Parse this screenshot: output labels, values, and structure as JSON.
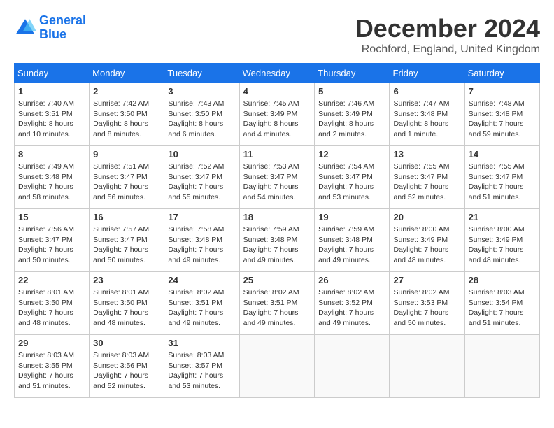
{
  "header": {
    "logo_line1": "General",
    "logo_line2": "Blue",
    "month": "December 2024",
    "location": "Rochford, England, United Kingdom"
  },
  "weekdays": [
    "Sunday",
    "Monday",
    "Tuesday",
    "Wednesday",
    "Thursday",
    "Friday",
    "Saturday"
  ],
  "weeks": [
    [
      {
        "day": "1",
        "sunrise": "7:40 AM",
        "sunset": "3:51 PM",
        "daylight_hours": "8 hours",
        "daylight_minutes": "10 minutes."
      },
      {
        "day": "2",
        "sunrise": "7:42 AM",
        "sunset": "3:50 PM",
        "daylight_hours": "8 hours",
        "daylight_minutes": "8 minutes."
      },
      {
        "day": "3",
        "sunrise": "7:43 AM",
        "sunset": "3:50 PM",
        "daylight_hours": "8 hours",
        "daylight_minutes": "6 minutes."
      },
      {
        "day": "4",
        "sunrise": "7:45 AM",
        "sunset": "3:49 PM",
        "daylight_hours": "8 hours",
        "daylight_minutes": "4 minutes."
      },
      {
        "day": "5",
        "sunrise": "7:46 AM",
        "sunset": "3:49 PM",
        "daylight_hours": "8 hours",
        "daylight_minutes": "2 minutes."
      },
      {
        "day": "6",
        "sunrise": "7:47 AM",
        "sunset": "3:48 PM",
        "daylight_hours": "8 hours",
        "daylight_minutes": "1 minute."
      },
      {
        "day": "7",
        "sunrise": "7:48 AM",
        "sunset": "3:48 PM",
        "daylight_hours": "7 hours",
        "daylight_minutes": "59 minutes."
      }
    ],
    [
      {
        "day": "8",
        "sunrise": "7:49 AM",
        "sunset": "3:48 PM",
        "daylight_hours": "7 hours",
        "daylight_minutes": "58 minutes."
      },
      {
        "day": "9",
        "sunrise": "7:51 AM",
        "sunset": "3:47 PM",
        "daylight_hours": "7 hours",
        "daylight_minutes": "56 minutes."
      },
      {
        "day": "10",
        "sunrise": "7:52 AM",
        "sunset": "3:47 PM",
        "daylight_hours": "7 hours",
        "daylight_minutes": "55 minutes."
      },
      {
        "day": "11",
        "sunrise": "7:53 AM",
        "sunset": "3:47 PM",
        "daylight_hours": "7 hours",
        "daylight_minutes": "54 minutes."
      },
      {
        "day": "12",
        "sunrise": "7:54 AM",
        "sunset": "3:47 PM",
        "daylight_hours": "7 hours",
        "daylight_minutes": "53 minutes."
      },
      {
        "day": "13",
        "sunrise": "7:55 AM",
        "sunset": "3:47 PM",
        "daylight_hours": "7 hours",
        "daylight_minutes": "52 minutes."
      },
      {
        "day": "14",
        "sunrise": "7:55 AM",
        "sunset": "3:47 PM",
        "daylight_hours": "7 hours",
        "daylight_minutes": "51 minutes."
      }
    ],
    [
      {
        "day": "15",
        "sunrise": "7:56 AM",
        "sunset": "3:47 PM",
        "daylight_hours": "7 hours",
        "daylight_minutes": "50 minutes."
      },
      {
        "day": "16",
        "sunrise": "7:57 AM",
        "sunset": "3:47 PM",
        "daylight_hours": "7 hours",
        "daylight_minutes": "50 minutes."
      },
      {
        "day": "17",
        "sunrise": "7:58 AM",
        "sunset": "3:48 PM",
        "daylight_hours": "7 hours",
        "daylight_minutes": "49 minutes."
      },
      {
        "day": "18",
        "sunrise": "7:59 AM",
        "sunset": "3:48 PM",
        "daylight_hours": "7 hours",
        "daylight_minutes": "49 minutes."
      },
      {
        "day": "19",
        "sunrise": "7:59 AM",
        "sunset": "3:48 PM",
        "daylight_hours": "7 hours",
        "daylight_minutes": "49 minutes."
      },
      {
        "day": "20",
        "sunrise": "8:00 AM",
        "sunset": "3:49 PM",
        "daylight_hours": "7 hours",
        "daylight_minutes": "48 minutes."
      },
      {
        "day": "21",
        "sunrise": "8:00 AM",
        "sunset": "3:49 PM",
        "daylight_hours": "7 hours",
        "daylight_minutes": "48 minutes."
      }
    ],
    [
      {
        "day": "22",
        "sunrise": "8:01 AM",
        "sunset": "3:50 PM",
        "daylight_hours": "7 hours",
        "daylight_minutes": "48 minutes."
      },
      {
        "day": "23",
        "sunrise": "8:01 AM",
        "sunset": "3:50 PM",
        "daylight_hours": "7 hours",
        "daylight_minutes": "48 minutes."
      },
      {
        "day": "24",
        "sunrise": "8:02 AM",
        "sunset": "3:51 PM",
        "daylight_hours": "7 hours",
        "daylight_minutes": "49 minutes."
      },
      {
        "day": "25",
        "sunrise": "8:02 AM",
        "sunset": "3:51 PM",
        "daylight_hours": "7 hours",
        "daylight_minutes": "49 minutes."
      },
      {
        "day": "26",
        "sunrise": "8:02 AM",
        "sunset": "3:52 PM",
        "daylight_hours": "7 hours",
        "daylight_minutes": "49 minutes."
      },
      {
        "day": "27",
        "sunrise": "8:02 AM",
        "sunset": "3:53 PM",
        "daylight_hours": "7 hours",
        "daylight_minutes": "50 minutes."
      },
      {
        "day": "28",
        "sunrise": "8:03 AM",
        "sunset": "3:54 PM",
        "daylight_hours": "7 hours",
        "daylight_minutes": "51 minutes."
      }
    ],
    [
      {
        "day": "29",
        "sunrise": "8:03 AM",
        "sunset": "3:55 PM",
        "daylight_hours": "7 hours",
        "daylight_minutes": "51 minutes."
      },
      {
        "day": "30",
        "sunrise": "8:03 AM",
        "sunset": "3:56 PM",
        "daylight_hours": "7 hours",
        "daylight_minutes": "52 minutes."
      },
      {
        "day": "31",
        "sunrise": "8:03 AM",
        "sunset": "3:57 PM",
        "daylight_hours": "7 hours",
        "daylight_minutes": "53 minutes."
      },
      null,
      null,
      null,
      null
    ]
  ]
}
